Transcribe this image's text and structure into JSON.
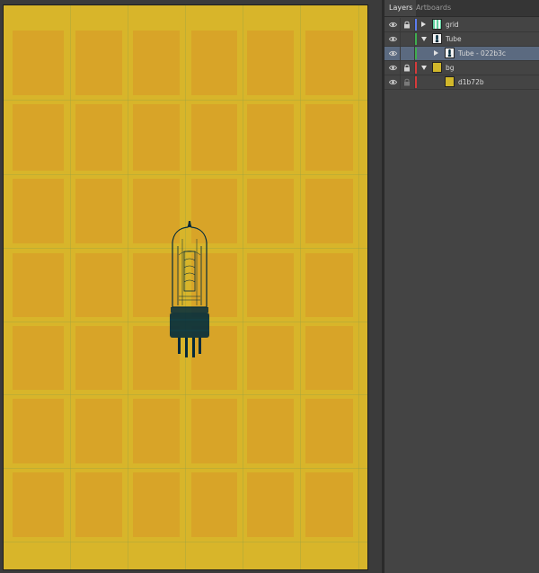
{
  "panel": {
    "tabs": [
      {
        "label": "Layers",
        "active": true
      },
      {
        "label": "Artboards",
        "active": false
      }
    ],
    "layers": [
      {
        "name": "grid",
        "level": 0,
        "expanded": false,
        "visible": true,
        "locked": true,
        "color": "#5c7cf0",
        "thumb": "stripes-icon",
        "selected": false
      },
      {
        "name": "Tube",
        "level": 0,
        "expanded": true,
        "visible": true,
        "locked": false,
        "color": "#3fae4f",
        "thumb": "tube-icon",
        "selected": false
      },
      {
        "name": "Tube - 022b3c",
        "level": 1,
        "expanded": false,
        "visible": true,
        "locked": false,
        "color": "#3fae4f",
        "thumb": "tube-icon",
        "selected": true
      },
      {
        "name": "bg",
        "level": 0,
        "expanded": true,
        "visible": true,
        "locked": true,
        "color": "#d63b3b",
        "thumb": "yellow-swatch-icon",
        "selected": false
      },
      {
        "name": "d1b72b",
        "level": 1,
        "expanded": false,
        "visible": true,
        "locked": true,
        "color": "#d63b3b",
        "thumb": "yellow-swatch-icon",
        "selected": false
      }
    ]
  },
  "colors": {
    "artboard": "#d8b52a",
    "grid_cell": "#d8a428",
    "tube": "#022b3c",
    "bg_swatch": "#d1b72b"
  }
}
